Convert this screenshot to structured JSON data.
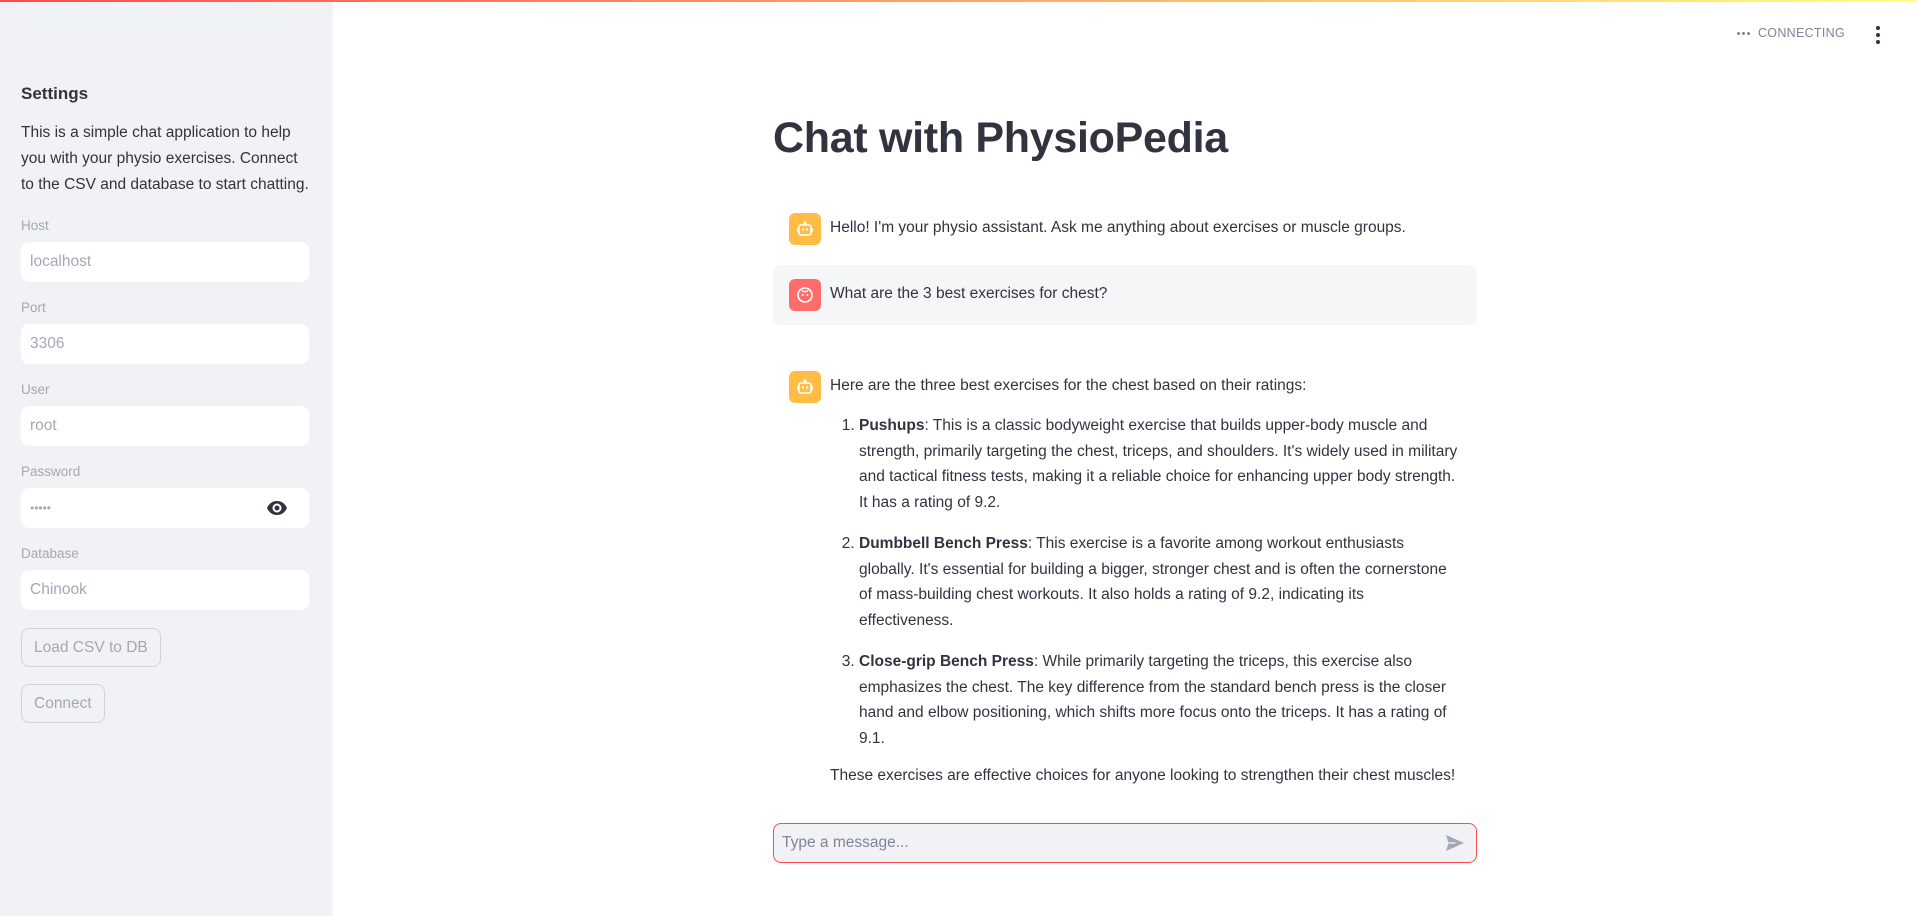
{
  "sidebar": {
    "title": "Settings",
    "description": "This is a simple chat application to help you with your physio exercises. Connect to the CSV and database to start chatting.",
    "fields": {
      "host": {
        "label": "Host",
        "placeholder": "localhost"
      },
      "port": {
        "label": "Port",
        "placeholder": "3306"
      },
      "user": {
        "label": "User",
        "placeholder": "root"
      },
      "password": {
        "label": "Password",
        "value": "•••••"
      },
      "database": {
        "label": "Database",
        "placeholder": "Chinook"
      }
    },
    "buttons": {
      "load_csv": "Load CSV to DB",
      "connect": "Connect"
    }
  },
  "header": {
    "status": "CONNECTING"
  },
  "main": {
    "title": "Chat with PhysioPedia",
    "messages": {
      "greeting": "Hello! I'm your physio assistant. Ask me anything about exercises or muscle groups.",
      "user_question": "What are the 3 best exercises for chest?",
      "answer_intro": "Here are the three best exercises for the chest based on their ratings:",
      "answer_items": [
        {
          "name": "Pushups",
          "text": ": This is a classic bodyweight exercise that builds upper-body muscle and strength, primarily targeting the chest, triceps, and shoulders. It's widely used in military and tactical fitness tests, making it a reliable choice for enhancing upper body strength. It has a rating of 9.2."
        },
        {
          "name": "Dumbbell Bench Press",
          "text": ": This exercise is a favorite among workout enthusiasts globally. It's essential for building a bigger, stronger chest and is often the cornerstone of mass-building chest workouts. It also holds a rating of 9.2, indicating its effectiveness."
        },
        {
          "name": "Close-grip Bench Press",
          "text": ": While primarily targeting the triceps, this exercise also emphasizes the chest. The key difference from the standard bench press is the closer hand and elbow positioning, which shifts more focus onto the triceps. It has a rating of 9.1."
        }
      ],
      "answer_closing": "These exercises are effective choices for anyone looking to strengthen their chest muscles!"
    },
    "chat_input": {
      "placeholder": "Type a message..."
    }
  },
  "colors": {
    "accent": "#ff4b4b",
    "bot_avatar": "#ffbd45",
    "user_avatar": "#ff6c6c",
    "sidebar_bg": "#f0f2f6"
  },
  "icons": [
    "dots-icon",
    "menu-icon",
    "eye-icon",
    "bot-avatar-icon",
    "user-avatar-icon",
    "send-icon"
  ]
}
